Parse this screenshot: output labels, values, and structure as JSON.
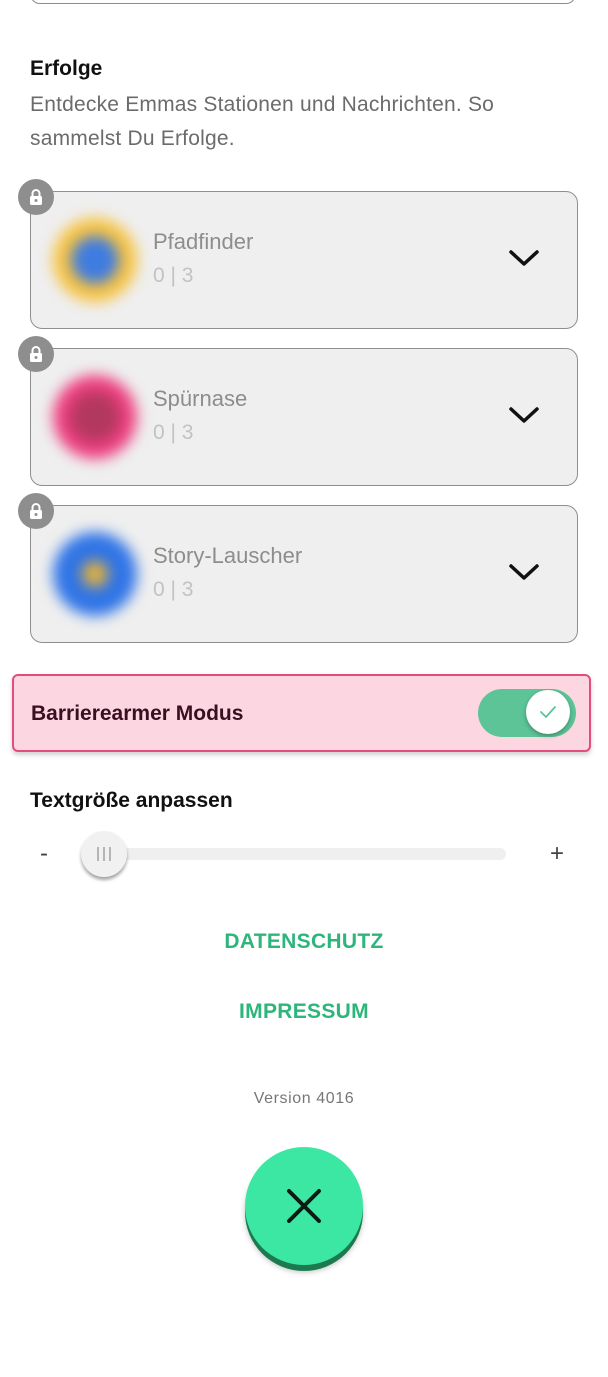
{
  "achievements": {
    "title": "Erfolge",
    "description": "Entdecke Emmas Stationen und Nachrichten. So sammelst Du Erfolge.",
    "items": [
      {
        "name": "Pfadfinder",
        "progress": "0 | 3",
        "badge_colors": [
          "#3f7ce0",
          "#f7c240"
        ],
        "locked": true
      },
      {
        "name": "Spürnase",
        "progress": "0 | 3",
        "badge_colors": [
          "#b3385f",
          "#ee3f7f"
        ],
        "locked": true
      },
      {
        "name": "Story-Lauscher",
        "progress": "0 | 3",
        "badge_colors": [
          "#e5b13a",
          "#2f74e6"
        ],
        "locked": true
      }
    ]
  },
  "accessibility": {
    "label": "Barrierearmer Modus",
    "enabled": true
  },
  "text_size": {
    "label": "Textgröße anpassen",
    "minus": "-",
    "plus": "+",
    "value_fraction": 0.0
  },
  "links": {
    "privacy": "DATENSCHUTZ",
    "imprint": "IMPRESSUM"
  },
  "version": "Version 4016",
  "colors": {
    "accent_green": "#2db57c",
    "fab": "#3ce7a3",
    "toggle_on": "#5cc497",
    "highlight_bg": "#fcd7e2",
    "highlight_border": "#e34d7e"
  }
}
